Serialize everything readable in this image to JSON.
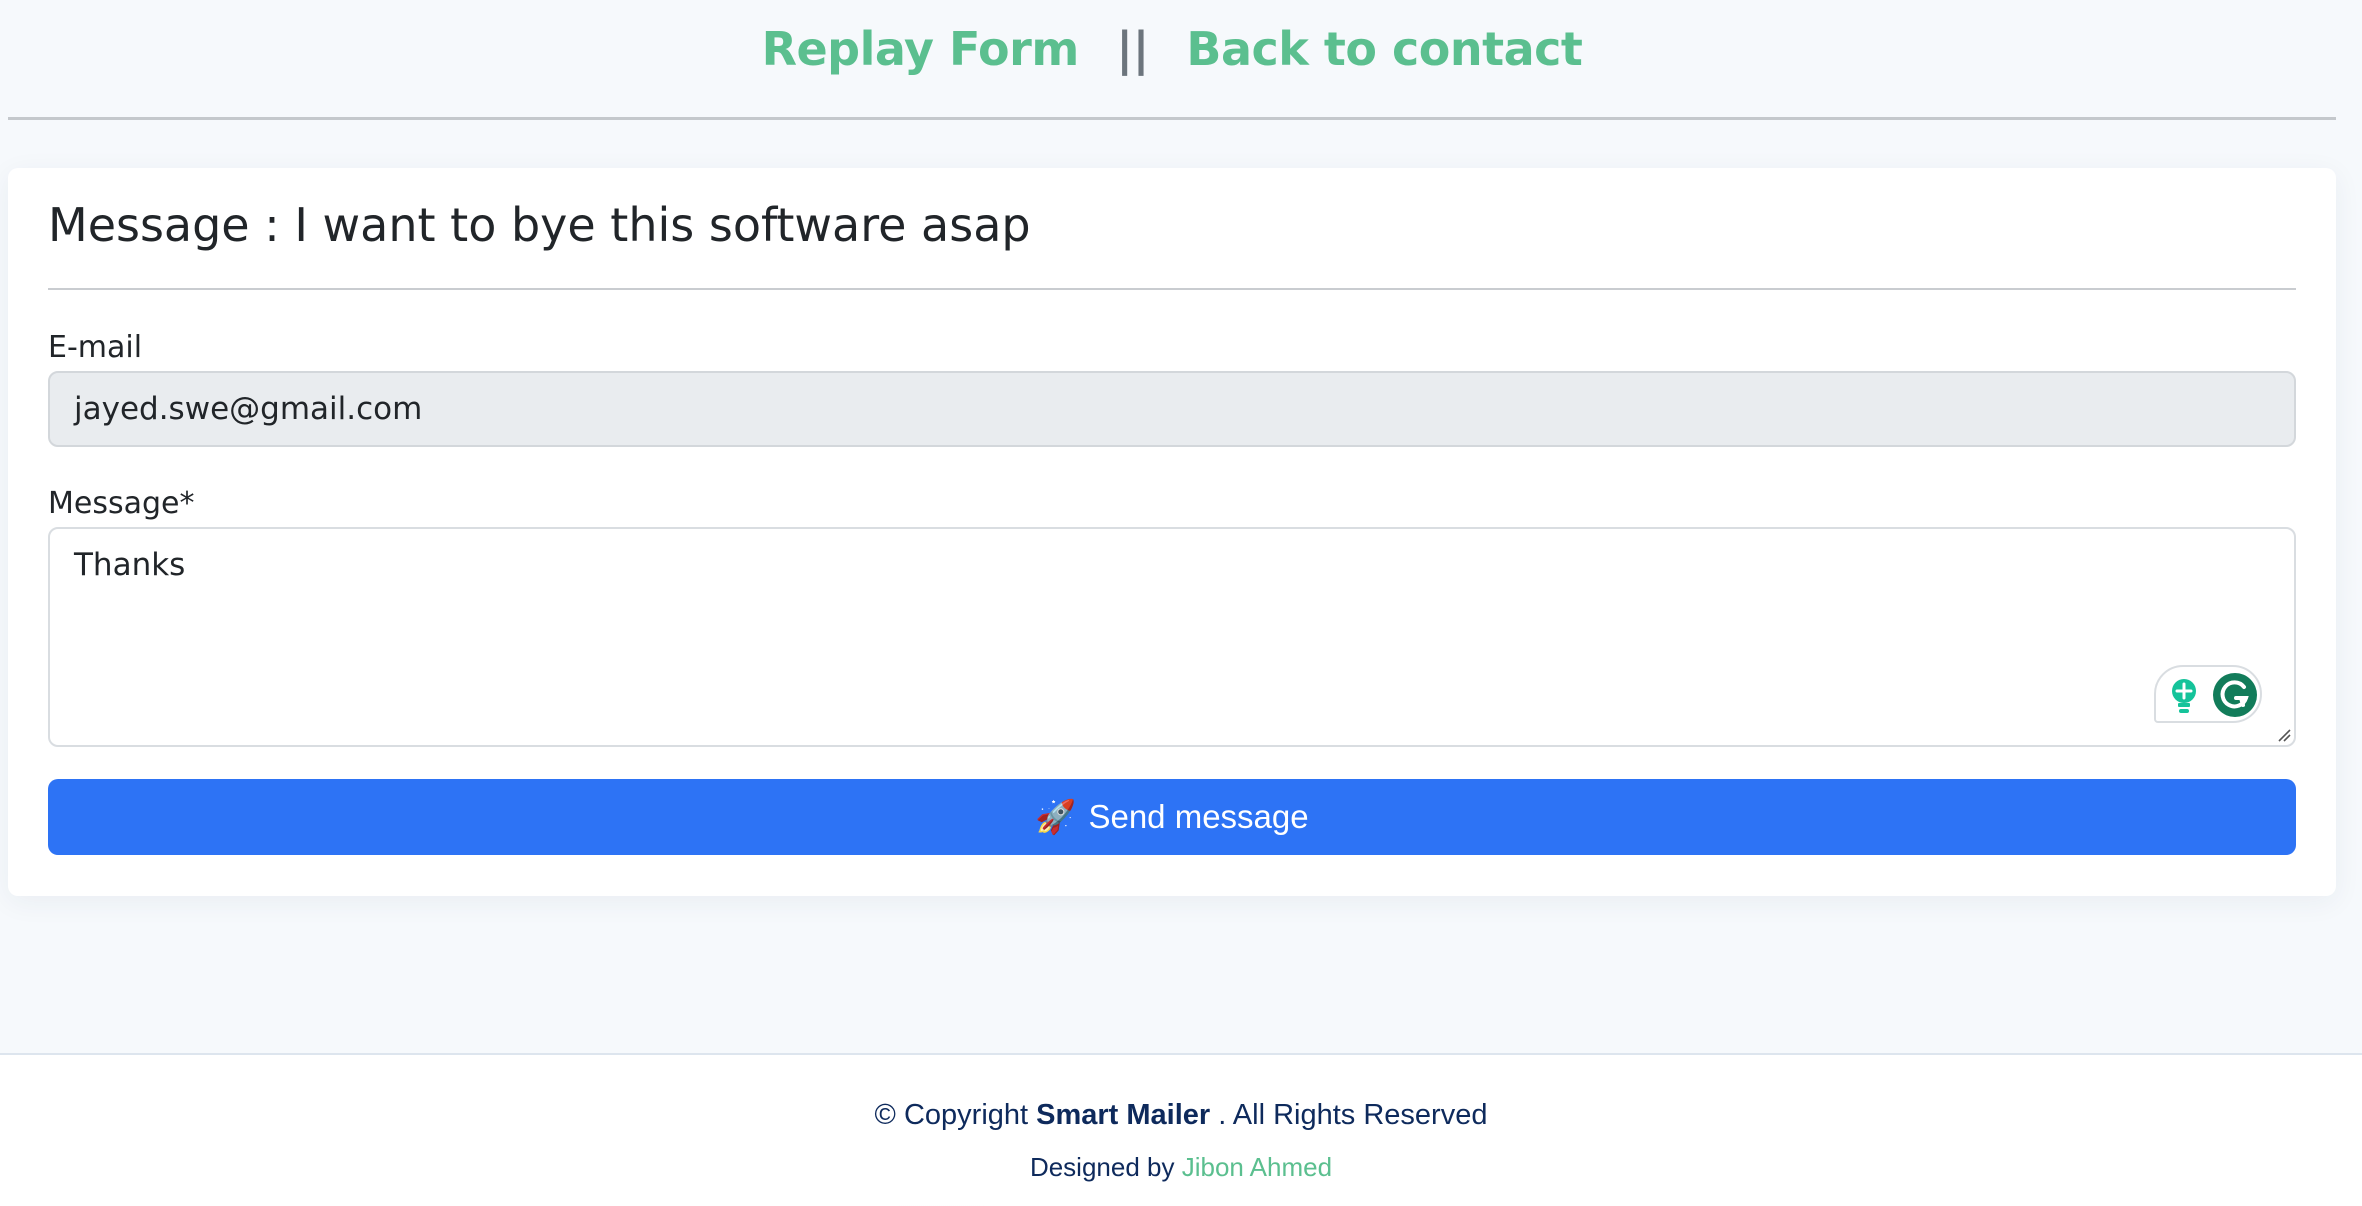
{
  "header": {
    "replay_form_link": "Replay Form",
    "separator": "||",
    "back_to_contact_link": "Back to contact"
  },
  "card": {
    "title": "Message : I want to bye this software asap",
    "email_label": "E-mail",
    "email_value": "jayed.swe@gmail.com",
    "message_label": "Message*",
    "message_value": "Thanks",
    "send_button_icon": "🚀",
    "send_button_label": "Send message"
  },
  "footer": {
    "copyright_prefix": "© Copyright",
    "brand": "Smart Mailer",
    "copyright_suffix": ". All Rights Reserved",
    "designed_by_prefix": "Designed by",
    "designer_name": "Jibon Ahmed"
  },
  "colors": {
    "accent_green": "#5bbf8f",
    "primary_blue": "#2d73f5",
    "footer_text": "#0e2a5c"
  },
  "icons": [
    "lightbulb-icon",
    "grammarly-icon",
    "resize-handle-icon",
    "rocket-icon"
  ]
}
